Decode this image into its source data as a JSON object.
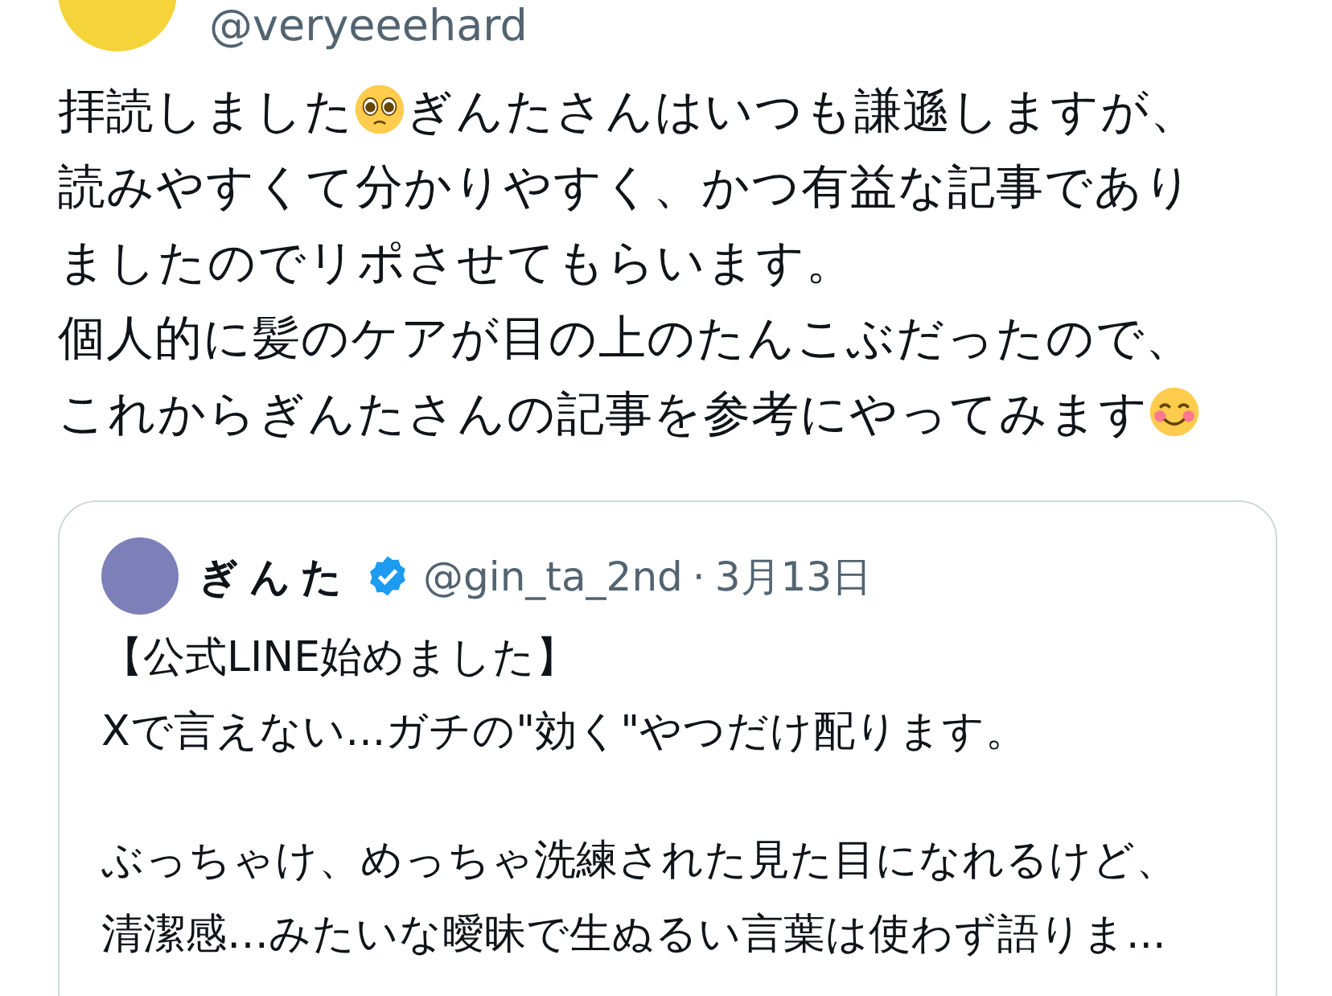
{
  "author": {
    "handle": "@veryeeehard"
  },
  "paragraphs": [
    {
      "lines": [
        [
          {
            "kind": "text",
            "text": "拝読しました"
          },
          {
            "kind": "pleading"
          },
          {
            "kind": "text",
            "text": "ぎんたさんはいつも謙遜しますが、"
          }
        ],
        [
          {
            "kind": "text",
            "text": "読みやすくて分かりやすく、かつ有益な記事であり"
          }
        ],
        [
          {
            "kind": "text",
            "text": "ましたのでリポさせてもらいます。"
          }
        ]
      ]
    },
    {
      "lines": [
        [
          {
            "kind": "text",
            "text": "個人的に髪のケアが目の上のたんこぶだったので、"
          }
        ],
        [
          {
            "kind": "text",
            "text": "これからぎんたさんの記事を参考にやってみます"
          },
          {
            "kind": "smiling"
          }
        ]
      ]
    }
  ],
  "quote": {
    "name": "ぎんた",
    "verified": true,
    "handle": "@gin_ta_2nd",
    "separator": "·",
    "date": "3月13日",
    "paragraphs": [
      [
        "【公式LINE始めました】",
        "Xで言えない...ガチの\"効く\"やつだけ配ります。"
      ],
      [
        "ぶっちゃけ、めっちゃ洗練された見た目になれるけど、",
        "清潔感…みたいな曖昧で生ぬるい言葉は使わず語りま..."
      ]
    ]
  }
}
